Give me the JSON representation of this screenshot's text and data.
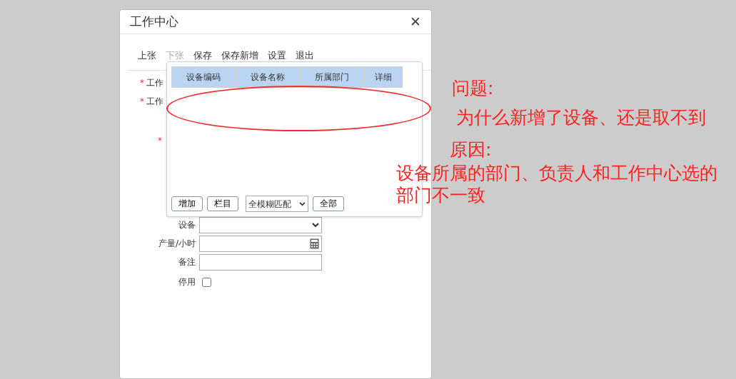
{
  "window": {
    "title": "工作中心",
    "close": "✕"
  },
  "toolbar": [
    {
      "label": "上张",
      "disabled": false
    },
    {
      "label": "下张",
      "disabled": true
    },
    {
      "label": "保存",
      "disabled": false
    },
    {
      "label": "保存新增",
      "disabled": false
    },
    {
      "label": "设置",
      "disabled": false
    },
    {
      "label": "退出",
      "disabled": false
    }
  ],
  "hidden_rows": [
    {
      "mark": "*",
      "label": "工作"
    },
    {
      "mark": "*",
      "label": "工作"
    },
    {
      "mark": "*"
    }
  ],
  "form": [
    {
      "kind": "select",
      "label": "设备"
    },
    {
      "kind": "number",
      "label": "产量/小时"
    },
    {
      "kind": "text",
      "label": "备注"
    },
    {
      "kind": "checkbox",
      "label": "停用",
      "checked": false
    }
  ],
  "popup": {
    "columns": [
      "设备编码",
      "设备名称",
      "所属部门",
      "详细"
    ],
    "buttons": [
      "增加",
      "栏目"
    ],
    "match_select": {
      "value": "全模糊匹配"
    },
    "all_button": "全部"
  },
  "annotations": [
    {
      "kind": "heading",
      "text": "问题:"
    },
    {
      "kind": "body",
      "text": "为什么新增了设备、还是取不到"
    },
    {
      "kind": "heading",
      "text": "原因:"
    },
    {
      "kind": "body",
      "text": "设备所属的部门、负责人和工作中心选的部门不一致"
    }
  ]
}
